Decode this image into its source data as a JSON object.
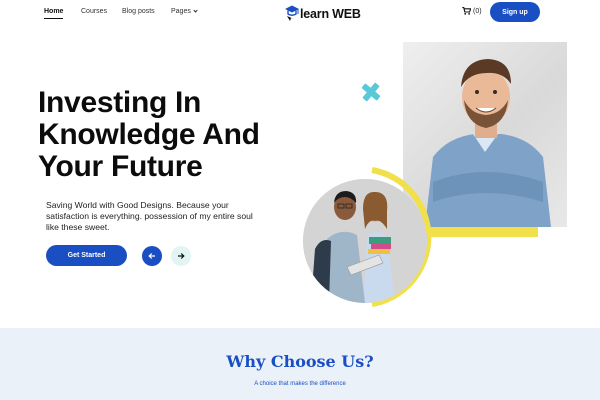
{
  "nav": {
    "links": [
      "Home",
      "Courses",
      "Blog posts",
      "Pages"
    ],
    "brand": "learn WEB",
    "cart_count": "(0)",
    "signup_label": "Sign up"
  },
  "hero": {
    "title": "Investing In Knowledge And Your Future",
    "description": "Saving World with Good Designs. Because your satisfaction is everything. possession of my entire soul like these sweet.",
    "cta_label": "Get Started"
  },
  "why": {
    "title": "Why Choose Us?",
    "subtitle": "A choice that makes the difference"
  },
  "colors": {
    "primary": "#1a4fc4",
    "accent_yellow": "#f1e04a",
    "accent_teal": "#5bc8d8",
    "section_bg": "#ebf1f9"
  },
  "icons": [
    "graduation-cap-icon",
    "chevron-down-icon",
    "cart-icon",
    "arrow-left-icon",
    "arrow-right-icon"
  ]
}
